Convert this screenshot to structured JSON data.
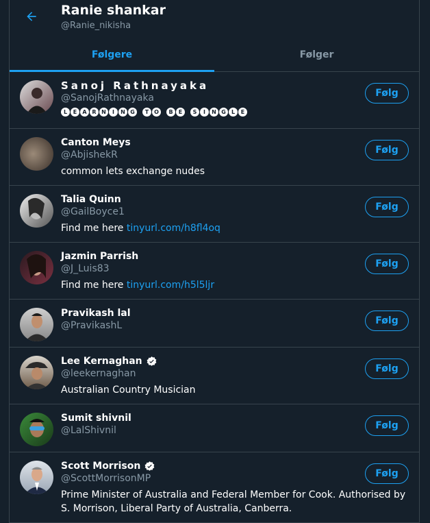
{
  "header": {
    "title": "Ranie shankar",
    "handle": "@Ranie_nikisha",
    "back_icon": "arrow-left-icon"
  },
  "tabs": [
    {
      "label": "Følgere",
      "active": true
    },
    {
      "label": "Følger",
      "active": false
    }
  ],
  "colors": {
    "accent": "#1da1f2",
    "background": "#15202b",
    "muted": "#8899a6",
    "border": "#38444d"
  },
  "users": [
    {
      "name": "Sanoj Rathnayaka",
      "handle": "@SanojRathnayaka",
      "bio": "LEARNING TO BE SINGLE",
      "bio_style": "circled",
      "verified": false,
      "follow_label": "Følg"
    },
    {
      "name": "Canton Meys",
      "handle": "@AbjishekR",
      "bio": "common lets exchange nudes",
      "verified": false,
      "follow_label": "Følg"
    },
    {
      "name": "Talia Quinn",
      "handle": "@GailBoyce1",
      "bio_prefix": "Find me here ",
      "bio_link": "tinyurl.com/h8fl4oq",
      "verified": false,
      "follow_label": "Følg"
    },
    {
      "name": "Jazmin Parrish",
      "handle": "@J_Luis83",
      "bio_prefix": "Find me here ",
      "bio_link": "tinyurl.com/h5l5ljr",
      "verified": false,
      "follow_label": "Følg"
    },
    {
      "name": "Pravikash lal",
      "handle": "@PravikashL",
      "verified": false,
      "follow_label": "Følg"
    },
    {
      "name": "Lee Kernaghan",
      "handle": "@leekernaghan",
      "bio": "Australian Country Musician",
      "verified": true,
      "follow_label": "Følg"
    },
    {
      "name": "Sumit shivnil",
      "handle": "@LalShivnil",
      "verified": false,
      "follow_label": "Følg"
    },
    {
      "name": "Scott Morrison",
      "handle": "@ScottMorrisonMP",
      "bio": "Prime Minister of Australia and Federal Member for Cook. Authorised by S. Morrison, Liberal Party of Australia, Canberra.",
      "verified": true,
      "follow_label": "Følg"
    }
  ]
}
